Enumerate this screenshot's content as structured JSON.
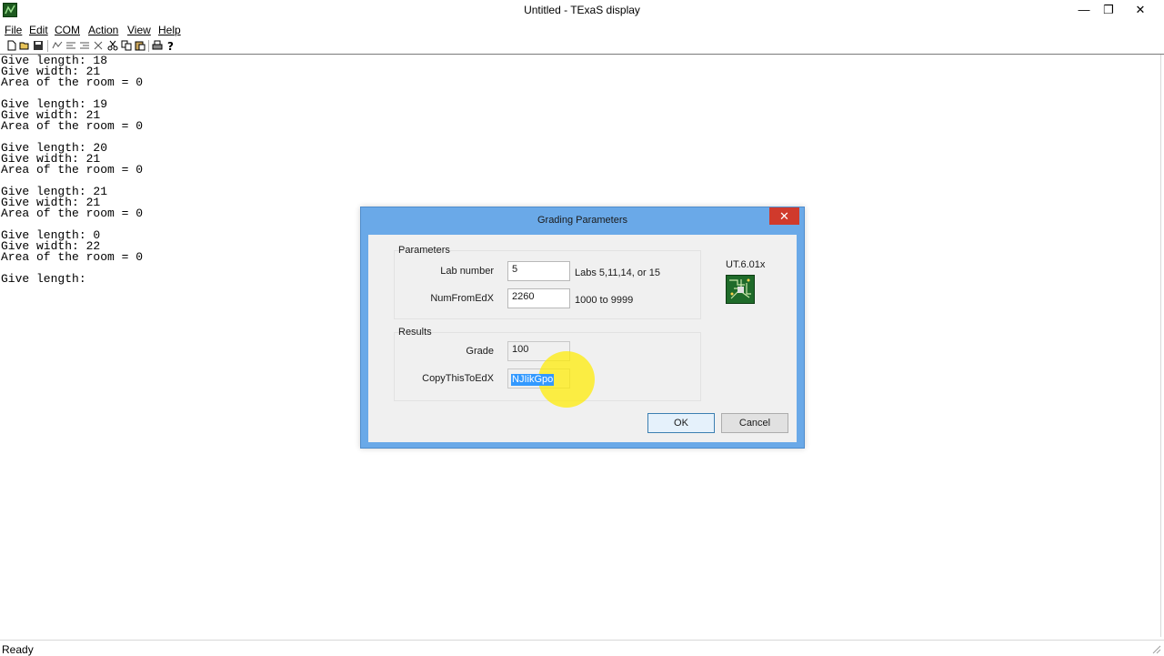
{
  "window": {
    "title": "Untitled - TExaS display",
    "controls": {
      "minimize": "—",
      "maximize": "❐",
      "close": "✕"
    }
  },
  "menu": {
    "items": [
      {
        "label": "File"
      },
      {
        "label": "Edit"
      },
      {
        "label": "COM"
      },
      {
        "label": "Action"
      },
      {
        "label": "View"
      },
      {
        "label": "Help"
      }
    ]
  },
  "toolbar": {
    "icons": [
      "new-icon",
      "open-icon",
      "save-icon",
      "tool-1-icon",
      "tool-2-icon",
      "tool-3-icon",
      "tool-4-icon",
      "cut-icon",
      "copy-icon",
      "paste-icon",
      "print-icon",
      "help-icon"
    ]
  },
  "terminal": {
    "lines": [
      "Give length: 18",
      "Give width: 21",
      "Area of the room = 0",
      "",
      "Give length: 19",
      "Give width: 21",
      "Area of the room = 0",
      "",
      "Give length: 20",
      "Give width: 21",
      "Area of the room = 0",
      "",
      "Give length: 21",
      "Give width: 21",
      "Area of the room = 0",
      "",
      "Give length: 0",
      "Give width: 22",
      "Area of the room = 0",
      "",
      "Give length:"
    ]
  },
  "status": {
    "text": "Ready"
  },
  "dialog": {
    "title": "Grading Parameters",
    "close": "✕",
    "parameters": {
      "group_label": "Parameters",
      "lab_number_label": "Lab number",
      "lab_number_value": "5",
      "lab_number_hint": "Labs 5,11,14, or 15",
      "numfromedx_label": "NumFromEdX",
      "numfromedx_value": "2260",
      "numfromedx_hint": "1000 to 9999"
    },
    "results": {
      "group_label": "Results",
      "grade_label": "Grade",
      "grade_value": "100",
      "copy_label": "CopyThisToEdX",
      "copy_value": "NJIikGpo"
    },
    "version": "UT.6.01x",
    "ok_label": "OK",
    "cancel_label": "Cancel"
  },
  "colors": {
    "dialog_frame": "#6aa9e8",
    "close_red": "#d03a2c",
    "selection_blue": "#3399ff",
    "cursor_highlight": "#ffeb00",
    "chip_green": "#1f6b2a"
  }
}
